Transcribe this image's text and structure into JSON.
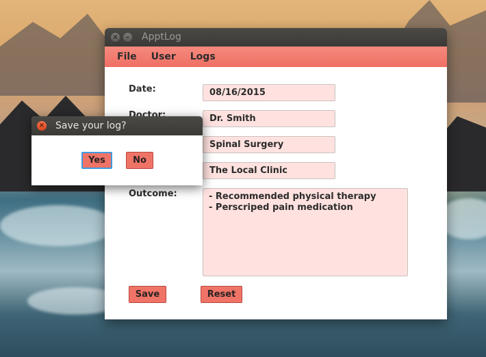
{
  "window": {
    "title": "ApptLog",
    "close_glyph": "×",
    "minimize_glyph": "–"
  },
  "menu": {
    "items": [
      "File",
      "User",
      "Logs"
    ]
  },
  "form": {
    "date_label": "Date:",
    "date_value": "08/16/2015",
    "doctor_label": "Doctor:",
    "doctor_value": "Dr. Smith",
    "specialty_value": "Spinal Surgery",
    "location_value": "The Local Clinic",
    "outcome_label": "Outcome:",
    "outcome_lines": [
      "- Recommended physical therapy",
      "- Perscriped pain medication"
    ]
  },
  "buttons": {
    "save": "Save",
    "reset": "Reset"
  },
  "dialog": {
    "title": "Save your log?",
    "close_glyph": "×",
    "yes": "Yes",
    "no": "No"
  },
  "colors": {
    "accent": "#ef6f63",
    "field_bg": "#ffe2df"
  }
}
